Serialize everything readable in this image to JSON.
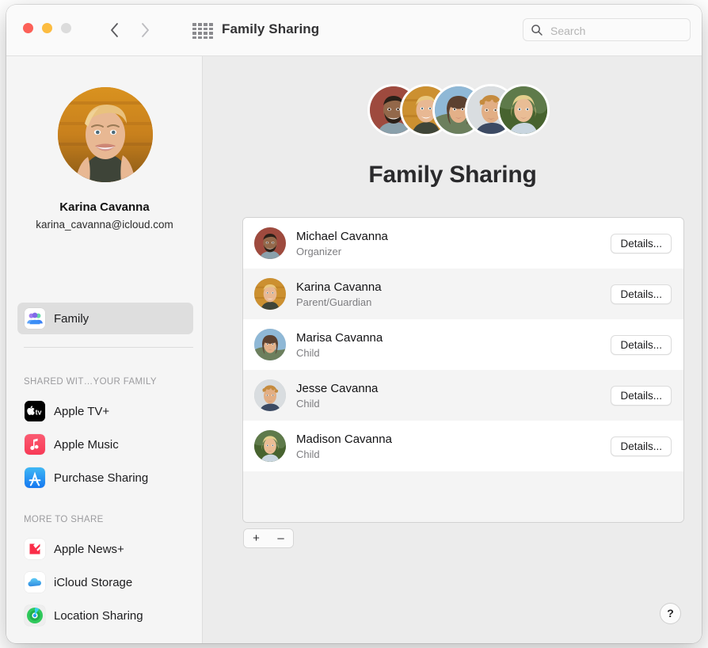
{
  "window": {
    "title": "Family Sharing",
    "traffic_lights": [
      "close",
      "minimize",
      "zoom"
    ]
  },
  "toolbar": {
    "back_icon": "chevron-left-icon",
    "forward_icon": "chevron-right-icon",
    "grid_icon": "show-all-grid-icon",
    "title": "Family Sharing",
    "search": {
      "icon": "search-icon",
      "placeholder": "Search",
      "value": ""
    }
  },
  "sidebar": {
    "account": {
      "avatar": "user-avatar-karina",
      "name": "Karina Cavanna",
      "email": "karina_cavanna@icloud.com"
    },
    "primary_items": [
      {
        "label": "Family",
        "icon": "family-group-icon",
        "selected": true
      }
    ],
    "sections": [
      {
        "header": "SHARED WIT…YOUR FAMILY",
        "items": [
          {
            "label": "Apple TV+",
            "icon": "apple-tv-plus-icon"
          },
          {
            "label": "Apple Music",
            "icon": "apple-music-icon"
          },
          {
            "label": "Purchase Sharing",
            "icon": "app-store-icon"
          }
        ]
      },
      {
        "header": "MORE TO SHARE",
        "items": [
          {
            "label": "Apple News+",
            "icon": "apple-news-plus-icon"
          },
          {
            "label": "iCloud Storage",
            "icon": "icloud-icon"
          },
          {
            "label": "Location Sharing",
            "icon": "find-my-icon"
          }
        ]
      }
    ]
  },
  "main": {
    "title": "Family Sharing",
    "avatar_cluster": [
      "avatar-michael",
      "avatar-karina",
      "avatar-marisa",
      "avatar-jesse",
      "avatar-madison"
    ],
    "members": [
      {
        "name": "Michael Cavanna",
        "role": "Organizer",
        "details_label": "Details...",
        "avatar": "avatar-michael"
      },
      {
        "name": "Karina Cavanna",
        "role": "Parent/Guardian",
        "details_label": "Details...",
        "avatar": "avatar-karina"
      },
      {
        "name": "Marisa Cavanna",
        "role": "Child",
        "details_label": "Details...",
        "avatar": "avatar-marisa"
      },
      {
        "name": "Jesse Cavanna",
        "role": "Child",
        "details_label": "Details...",
        "avatar": "avatar-jesse"
      },
      {
        "name": "Madison Cavanna",
        "role": "Child",
        "details_label": "Details...",
        "avatar": "avatar-madison"
      }
    ],
    "add_label": "+",
    "remove_label": "–",
    "help_label": "?"
  },
  "colors": {
    "window_bg": "#ececec",
    "sidebar_bg": "#f5f5f5",
    "toolbar_bg": "#fafafa",
    "selected_row": "#dedede",
    "alt_row": "#f4f4f4",
    "close": "#fc6058",
    "minimize": "#fcbc40",
    "zoom": "#dcdcdc"
  }
}
